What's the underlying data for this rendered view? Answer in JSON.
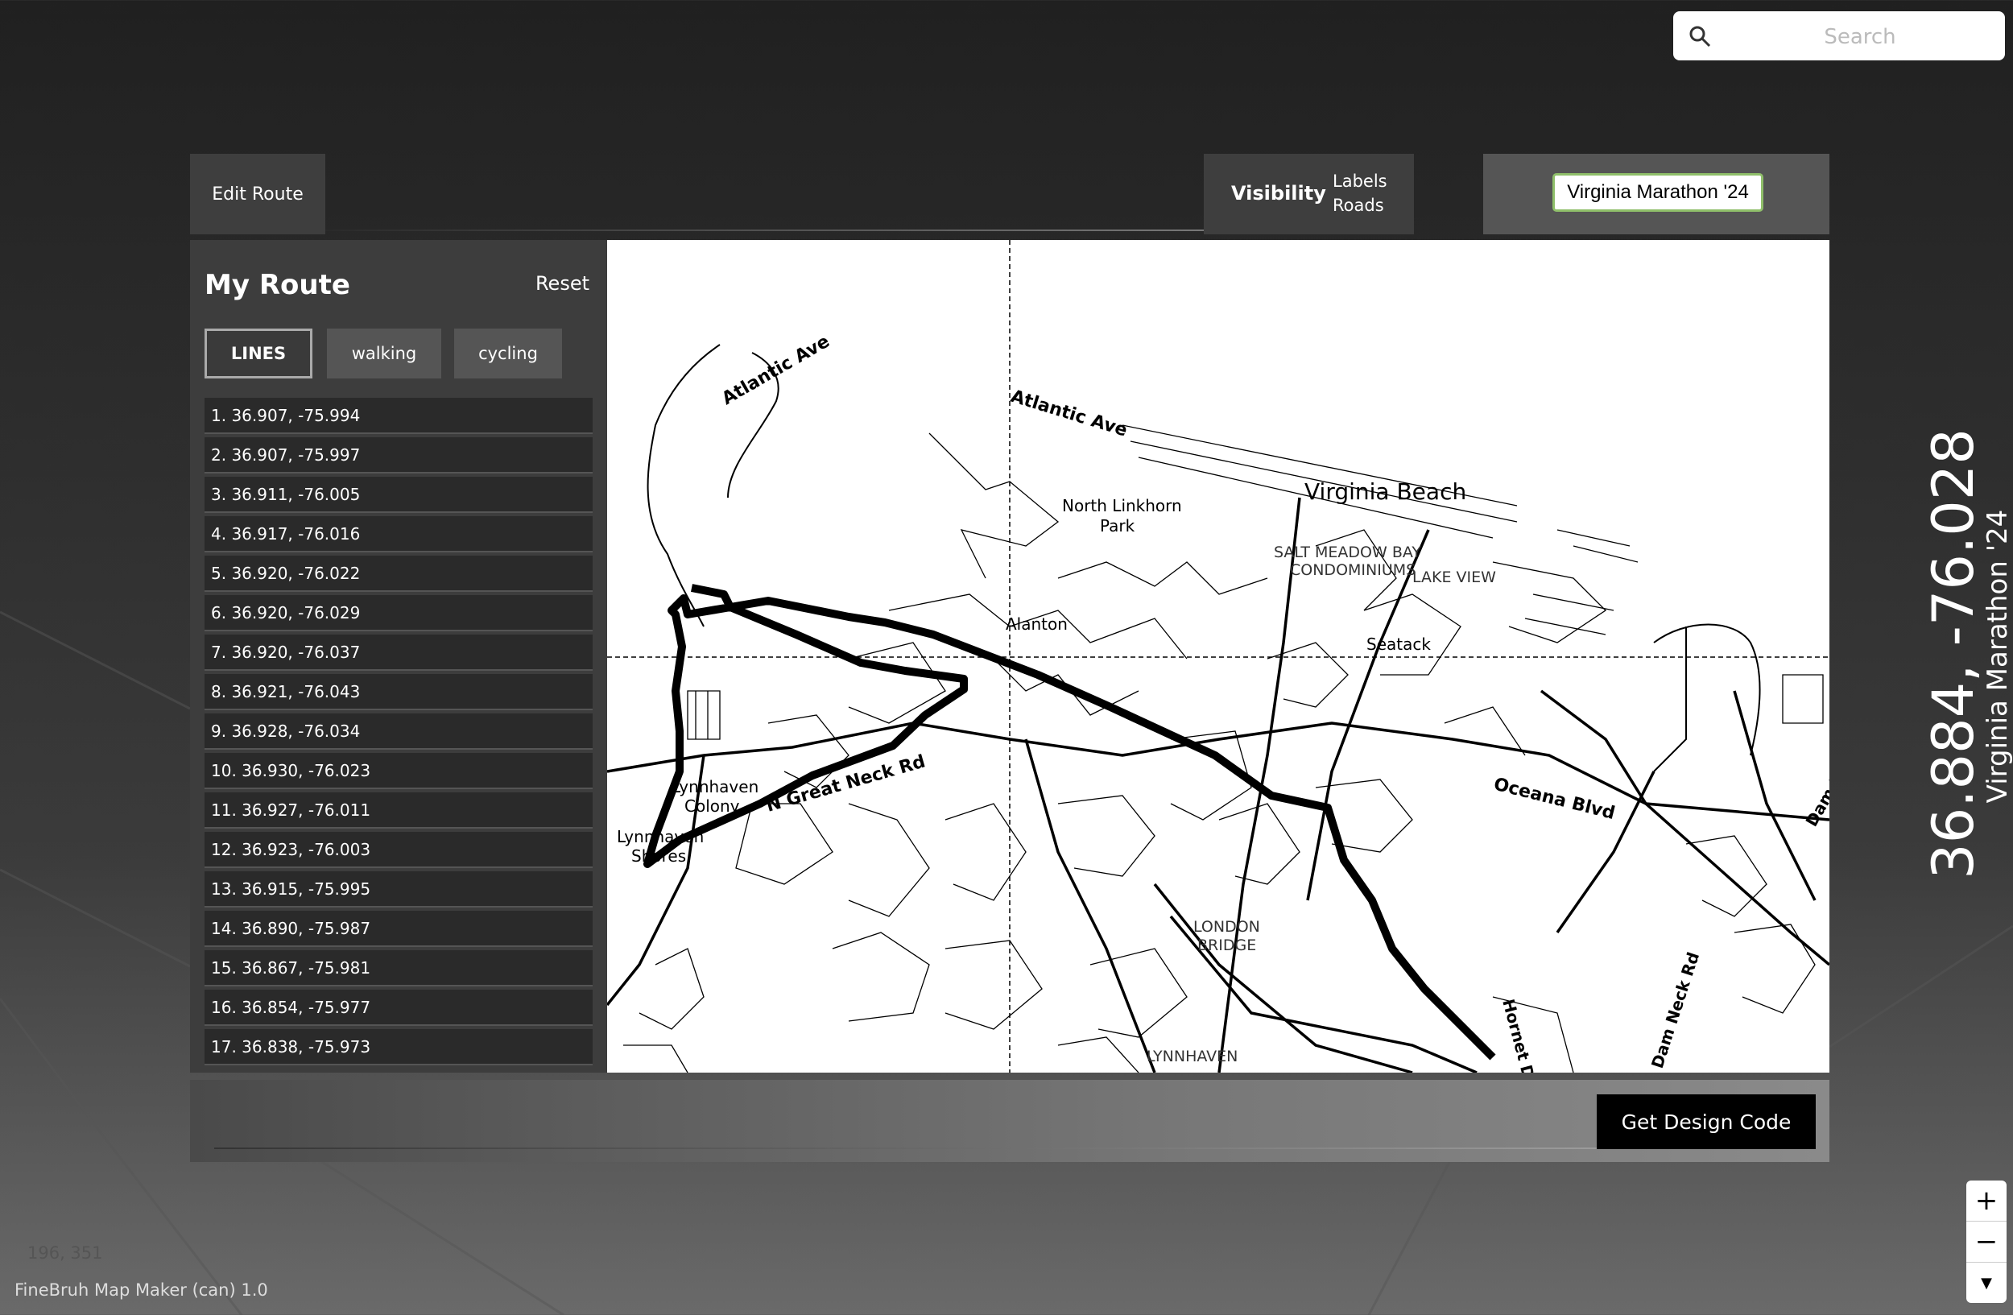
{
  "search": {
    "placeholder": "Search"
  },
  "toolbar": {
    "edit_route": "Edit Route",
    "visibility_label": "Visibility",
    "visibility_options": [
      "Labels",
      "Roads"
    ],
    "map_title_value": "Virginia Marathon '24"
  },
  "sidebar": {
    "title": "My Route",
    "reset": "Reset",
    "modes": [
      "LINES",
      "walking",
      "cycling"
    ],
    "waypoints": [
      "1. 36.907, -75.994",
      "2. 36.907, -75.997",
      "3. 36.911, -76.005",
      "4. 36.917, -76.016",
      "5. 36.920, -76.022",
      "6. 36.920, -76.029",
      "7. 36.920, -76.037",
      "8. 36.921, -76.043",
      "9. 36.928, -76.034",
      "10. 36.930, -76.023",
      "11. 36.927, -76.011",
      "12. 36.923, -76.003",
      "13. 36.915, -75.995",
      "14. 36.890, -75.987",
      "15. 36.867, -75.981",
      "16. 36.854, -75.977",
      "17. 36.838, -75.973"
    ]
  },
  "map": {
    "labels": {
      "atlantic_ave_1": "Atlantic Ave",
      "atlantic_ave_2": "Atlantic Ave",
      "virginia_beach": "Virginia Beach",
      "north_linkhorn_1": "North Linkhorn",
      "north_linkhorn_2": "Park",
      "salt_meadow_1": "SALT MEADOW BAY",
      "salt_meadow_2": "CONDOMINIUMS",
      "lake_view": "LAKE VIEW",
      "seatack": "Seatack",
      "alanton": "Alanton",
      "great_neck": "N Great Neck Rd",
      "lynnhaven_colony_1": "Lynnhaven",
      "lynnhaven_colony_2": "Colony",
      "lynnhaven_shores_1": "Lynnhaven",
      "lynnhaven_shores_2": "Shores",
      "oceana": "Oceana Blvd",
      "london_bridge_1": "LONDON",
      "london_bridge_2": "BRIDGE",
      "lynnhaven": "LYNNHAVEN",
      "hornet": "Hornet D",
      "dam_neck": "Dam Neck Rd",
      "dam_neck_2": "Dam N"
    },
    "route_color": "#000000"
  },
  "footer": {
    "design_code": "Get Design Code",
    "version": "FineBruh Map Maker (can) 1.0",
    "faint": "196, 351"
  },
  "poster": {
    "coordinates": "36.884, -76.028",
    "title": "Virginia Marathon '24"
  },
  "zoom": {
    "in": "+",
    "out": "−",
    "reset": "▼"
  }
}
